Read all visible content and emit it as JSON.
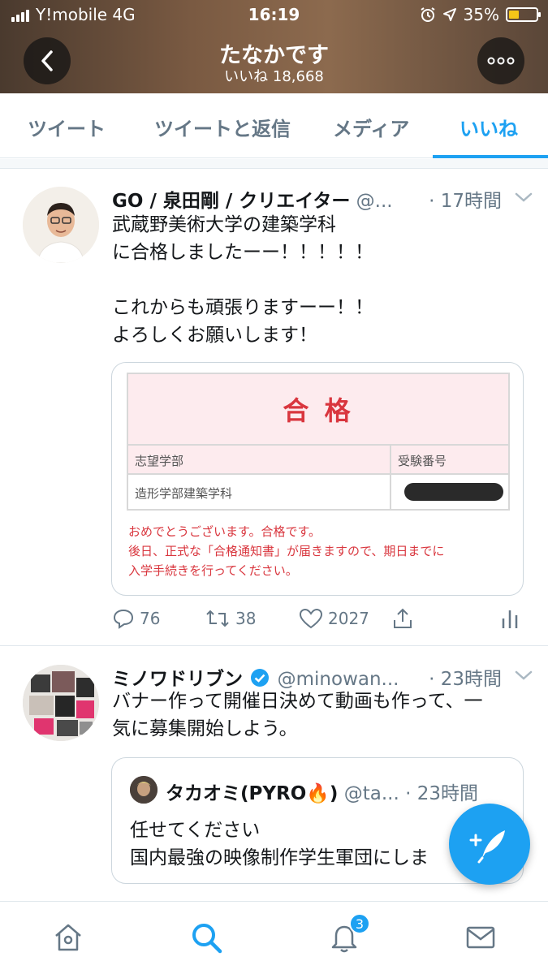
{
  "status_bar": {
    "carrier": "Y!mobile 4G",
    "time": "16:19",
    "battery": "35%"
  },
  "profile": {
    "title": "たなかです",
    "subtitle": "いいね 18,668"
  },
  "tabs": [
    {
      "label": "ツイート"
    },
    {
      "label": "ツイートと返信"
    },
    {
      "label": "メディア"
    },
    {
      "label": "いいね"
    }
  ],
  "tweets": [
    {
      "name": "GO / 泉田剛 / クリエイター",
      "handle": "@...",
      "time": "· 17時間",
      "text": "武蔵野美術大学の建築学科\nに合格しましたーー！！！！！\n\nこれからも頑張りますーー！！\nよろしくお願いします！",
      "card": {
        "heading": "合 格",
        "col1_header": "志望学部",
        "col2_header": "受験番号",
        "col1_value": "造形学部建築学科",
        "message": "おめでとうございます。合格です。\n後日、正式な「合格通知書」が届きますので、期日までに\n入学手続きを行ってください。"
      },
      "replies": "76",
      "retweets": "38",
      "likes": "2027"
    },
    {
      "name": "ミノワドリブン",
      "handle": "@minowan...",
      "time": "· 23時間",
      "text": "バナー作って開催日決めて動画も作って、一\n気に募集開始しよう。",
      "quote": {
        "name": "タカオミ(PYRO🔥)",
        "handle": "@ta...",
        "time": "· 23時間",
        "text": "任せてください\n国内最強の映像制作学生軍団にしま"
      }
    }
  ],
  "notifications_badge": "3",
  "colors": {
    "accent": "#1da1f2",
    "exam_red": "#d9363e",
    "exam_pink": "#fdebee"
  }
}
